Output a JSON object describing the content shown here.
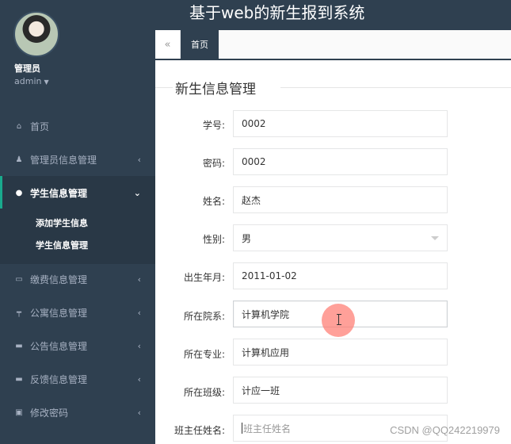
{
  "app": {
    "title": "基于web的新生报到系统"
  },
  "user": {
    "name": "管理员",
    "role": "admin"
  },
  "sidebar": {
    "items": [
      {
        "label": "首页",
        "icon": "home-icon"
      },
      {
        "label": "管理员信息管理",
        "icon": "user-tie-icon"
      },
      {
        "label": "学生信息管理",
        "icon": "user-icon",
        "expanded": true
      },
      {
        "label": "缴费信息管理",
        "icon": "monitor-icon"
      },
      {
        "label": "公寓信息管理",
        "icon": "building-icon"
      },
      {
        "label": "公告信息管理",
        "icon": "notice-icon"
      },
      {
        "label": "反馈信息管理",
        "icon": "feedback-icon"
      },
      {
        "label": "修改密码",
        "icon": "lock-icon"
      }
    ],
    "subitems": [
      {
        "label": "添加学生信息"
      },
      {
        "label": "学生信息管理"
      }
    ]
  },
  "tabs": {
    "back_icon": "double-chevron-left-icon",
    "home": "首页"
  },
  "form": {
    "title": "新生信息管理",
    "fields": [
      {
        "label": "学号:",
        "value": "0002"
      },
      {
        "label": "密码:",
        "value": "0002"
      },
      {
        "label": "姓名:",
        "value": "赵杰"
      },
      {
        "label": "性别:",
        "value": "男"
      },
      {
        "label": "出生年月:",
        "value": "2011-01-02"
      },
      {
        "label": "所在院系:",
        "value": "计算机学院"
      },
      {
        "label": "所在专业:",
        "value": "计算机应用"
      },
      {
        "label": "所在班级:",
        "value": "计应一班"
      },
      {
        "label": "班主任姓名:",
        "value": "",
        "placeholder": "班主任姓名"
      }
    ]
  },
  "watermark": "CSDN @QQ242219979"
}
